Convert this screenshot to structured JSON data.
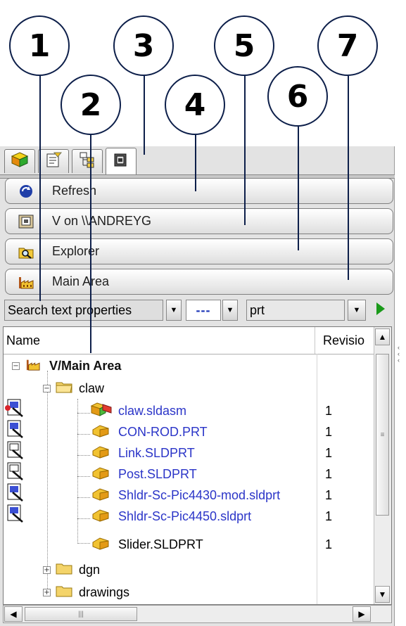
{
  "callouts": [
    "1",
    "2",
    "3",
    "4",
    "5",
    "6",
    "7"
  ],
  "tabs": [
    {
      "icon": "cube-icon"
    },
    {
      "icon": "properties-icon"
    },
    {
      "icon": "tree-icon"
    },
    {
      "icon": "vault-icon"
    }
  ],
  "buttons": [
    {
      "label": "Refresh",
      "icon": "refresh-icon"
    },
    {
      "label": "V on \\\\ANDREYG",
      "icon": "vault-view-icon"
    },
    {
      "label": "Explorer",
      "icon": "explorer-icon"
    },
    {
      "label": "Main Area",
      "icon": "factory-icon"
    }
  ],
  "search": {
    "property": "Search text properties",
    "operator": "---",
    "value": "prt"
  },
  "columns": {
    "name": "Name",
    "revision": "Revisio"
  },
  "tree": {
    "root": "V/Main Area",
    "folder": "claw",
    "files": [
      {
        "name": "claw.sldasm",
        "revision": "1",
        "color": "#2b35c8",
        "icon": "assembly-icon"
      },
      {
        "name": "CON-ROD.PRT",
        "revision": "1",
        "color": "#2b35c8",
        "icon": "part-icon"
      },
      {
        "name": "Link.SLDPRT",
        "revision": "1",
        "color": "#2b35c8",
        "icon": "part-icon"
      },
      {
        "name": "Post.SLDPRT",
        "revision": "1",
        "color": "#2b35c8",
        "icon": "part-icon"
      },
      {
        "name": "Shldr-Sc-Pic4430-mod.sldprt",
        "revision": "1",
        "color": "#2b35c8",
        "icon": "part-icon"
      },
      {
        "name": "Shldr-Sc-Pic4450.sldprt",
        "revision": "1",
        "color": "#2b35c8",
        "icon": "part-icon"
      },
      {
        "name": "Slider.SLDPRT",
        "revision": "1",
        "color": "#000000",
        "icon": "part-icon"
      }
    ],
    "folders": [
      "dgn",
      "drawings"
    ]
  },
  "colors": {
    "accent": "#2b35c8",
    "callout_border": "#0d1f4a",
    "go": "#1a9a1a"
  }
}
